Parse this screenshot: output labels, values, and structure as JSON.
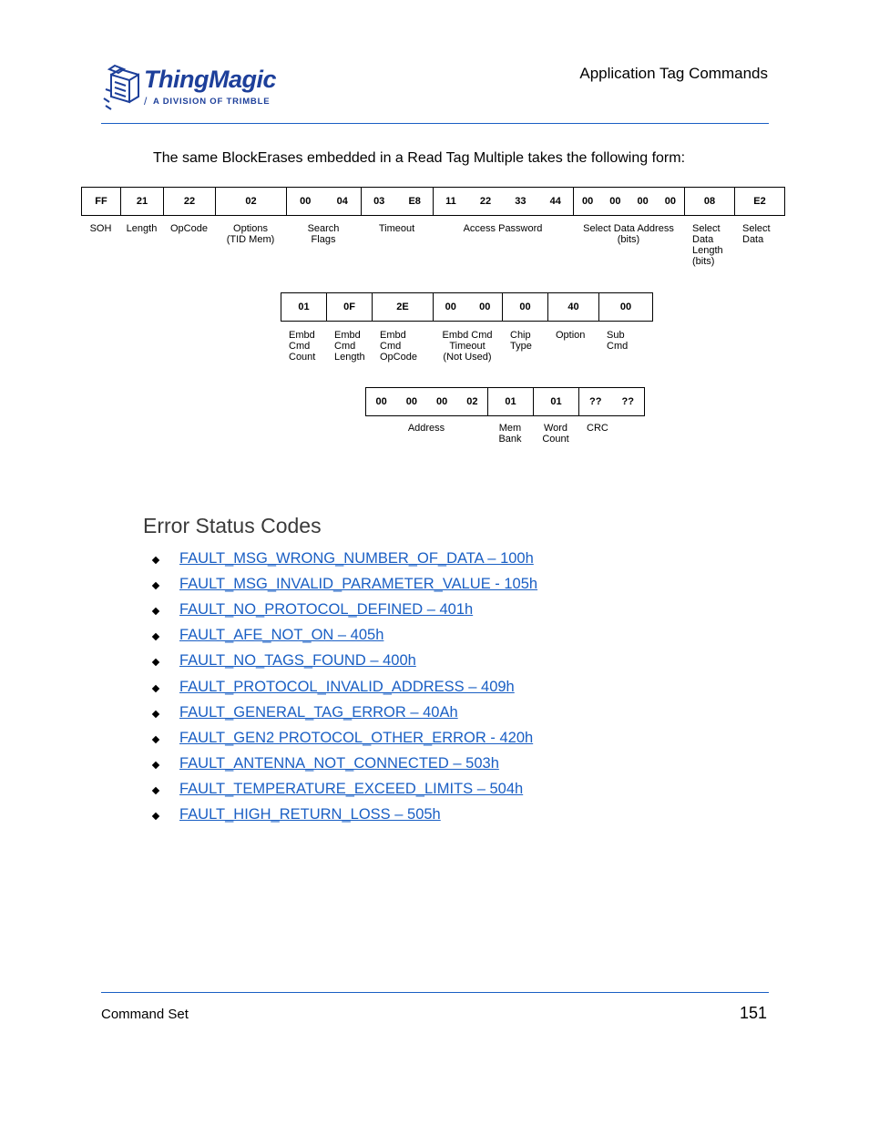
{
  "header": {
    "logo_name": "ThingMagic",
    "logo_tagline": "A DIVISION OF TRIMBLE",
    "section": "Application Tag Commands"
  },
  "intro": "The same BlockErases embedded in a Read Tag Multiple takes the following form:",
  "packet_row1": {
    "cells": [
      {
        "bytes": [
          "FF"
        ],
        "label": "SOH"
      },
      {
        "bytes": [
          "21"
        ],
        "label": "Length"
      },
      {
        "bytes": [
          "22"
        ],
        "label": "OpCode"
      },
      {
        "bytes": [
          "02"
        ],
        "label": "Options\n(TID Mem)"
      },
      {
        "bytes": [
          "00",
          "04"
        ],
        "label": "Search\nFlags"
      },
      {
        "bytes": [
          "03",
          "E8"
        ],
        "label": "Timeout"
      },
      {
        "bytes": [
          "11",
          "22",
          "33",
          "44"
        ],
        "label": "Access Password"
      },
      {
        "bytes": [
          "00",
          "00",
          "00",
          "00"
        ],
        "label": "Select Data Address\n(bits)"
      },
      {
        "bytes": [
          "08"
        ],
        "label": "Select\nData\nLength\n(bits)"
      },
      {
        "bytes": [
          "E2"
        ],
        "label": "Select\nData"
      }
    ]
  },
  "packet_row2": {
    "cells": [
      {
        "bytes": [
          "01"
        ],
        "label": "Embd\nCmd\nCount"
      },
      {
        "bytes": [
          "0F"
        ],
        "label": "Embd\nCmd\nLength"
      },
      {
        "bytes": [
          "2E"
        ],
        "label": "Embd\nCmd\nOpCode"
      },
      {
        "bytes": [
          "00",
          "00"
        ],
        "label": "Embd Cmd\nTimeout\n(Not Used)"
      },
      {
        "bytes": [
          "00"
        ],
        "label": "Chip\nType"
      },
      {
        "bytes": [
          "40"
        ],
        "label": "Option"
      },
      {
        "bytes": [
          "00"
        ],
        "label": "Sub\nCmd"
      }
    ]
  },
  "packet_row3": {
    "cells": [
      {
        "bytes": [
          "00",
          "00",
          "00",
          "02"
        ],
        "label": "Address"
      },
      {
        "bytes": [
          "01"
        ],
        "label": "Mem\nBank"
      },
      {
        "bytes": [
          "01"
        ],
        "label": "Word\nCount"
      },
      {
        "bytes": [
          "??",
          "??"
        ],
        "label": "CRC"
      }
    ]
  },
  "error_section": {
    "title": "Error Status Codes",
    "links": [
      "FAULT_MSG_WRONG_NUMBER_OF_DATA – 100h",
      "FAULT_MSG_INVALID_PARAMETER_VALUE - 105h",
      "FAULT_NO_PROTOCOL_DEFINED – 401h",
      "FAULT_AFE_NOT_ON – 405h",
      "FAULT_NO_TAGS_FOUND – 400h",
      "FAULT_PROTOCOL_INVALID_ADDRESS – 409h",
      "FAULT_GENERAL_TAG_ERROR – 40Ah",
      "FAULT_GEN2 PROTOCOL_OTHER_ERROR - 420h",
      "FAULT_ANTENNA_NOT_CONNECTED – 503h",
      "FAULT_TEMPERATURE_EXCEED_LIMITS – 504h",
      "FAULT_HIGH_RETURN_LOSS – 505h"
    ]
  },
  "footer": {
    "chapter": "Command Set",
    "page_number": "151"
  }
}
